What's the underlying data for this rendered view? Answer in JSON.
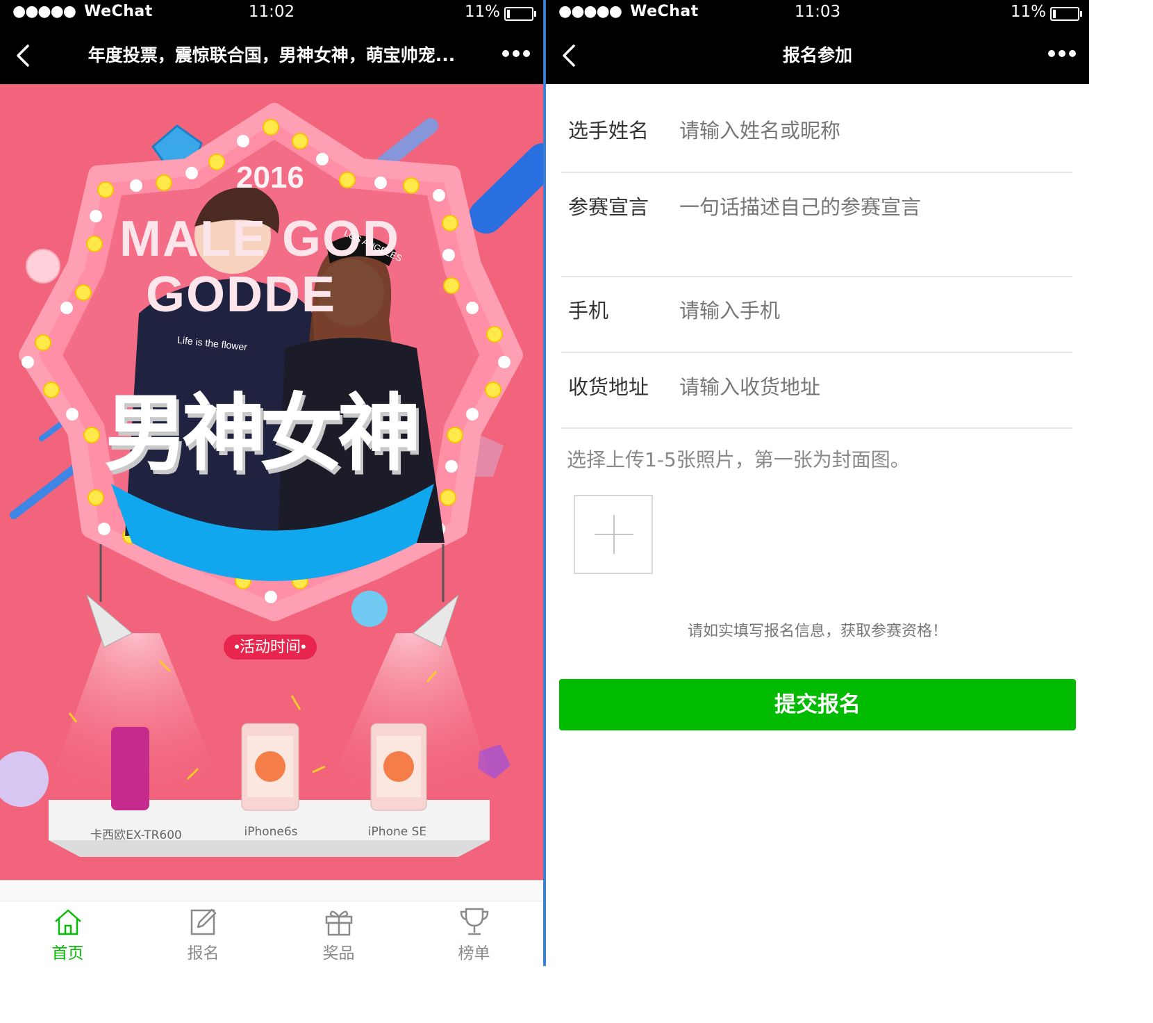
{
  "left": {
    "status": {
      "carrier": "WeChat",
      "signal": "●●●●●",
      "time": "11:02",
      "battery": "11%"
    },
    "nav": {
      "title": "年度投票，震惊联合国，男神女神，萌宝帅宠..."
    },
    "poster": {
      "year": "2016",
      "headline_en_1": "MALE GOD",
      "headline_en_2": "GODDE",
      "headline_cn": "男神女神",
      "shirt_text": "Life is the flower",
      "cap_text": "LOS ANGELES",
      "event_time_label": "•活动时间•",
      "prizes": [
        "卡西欧EX-TR600",
        "iPhone6s",
        "iPhone SE"
      ]
    },
    "tabbar": {
      "tabs": [
        {
          "label": "首页",
          "icon": "home-icon",
          "active": true
        },
        {
          "label": "报名",
          "icon": "edit-icon",
          "active": false
        },
        {
          "label": "奖品",
          "icon": "gift-icon",
          "active": false
        },
        {
          "label": "榜单",
          "icon": "trophy-icon",
          "active": false
        }
      ]
    },
    "colors": {
      "poster_bg": "#f2647c",
      "accent_green": "#09bb07"
    }
  },
  "right": {
    "status": {
      "carrier": "WeChat",
      "signal": "●●●●●",
      "time": "11:03",
      "battery": "11%"
    },
    "nav": {
      "title": "报名参加"
    },
    "form": {
      "name": {
        "label": "选手姓名",
        "placeholder": "请输入姓名或昵称"
      },
      "declaration": {
        "label": "参赛宣言",
        "placeholder": "一句话描述自己的参赛宣言"
      },
      "phone": {
        "label": "手机",
        "placeholder": "请输入手机"
      },
      "address": {
        "label": "收货地址",
        "placeholder": "请输入收货地址"
      },
      "upload_hint": "选择上传1-5张照片，第一张为封面图。",
      "notice": "请如实填写报名信息，获取参赛资格！",
      "submit_label": "提交报名"
    },
    "colors": {
      "submit_bg": "#00bb00"
    }
  }
}
